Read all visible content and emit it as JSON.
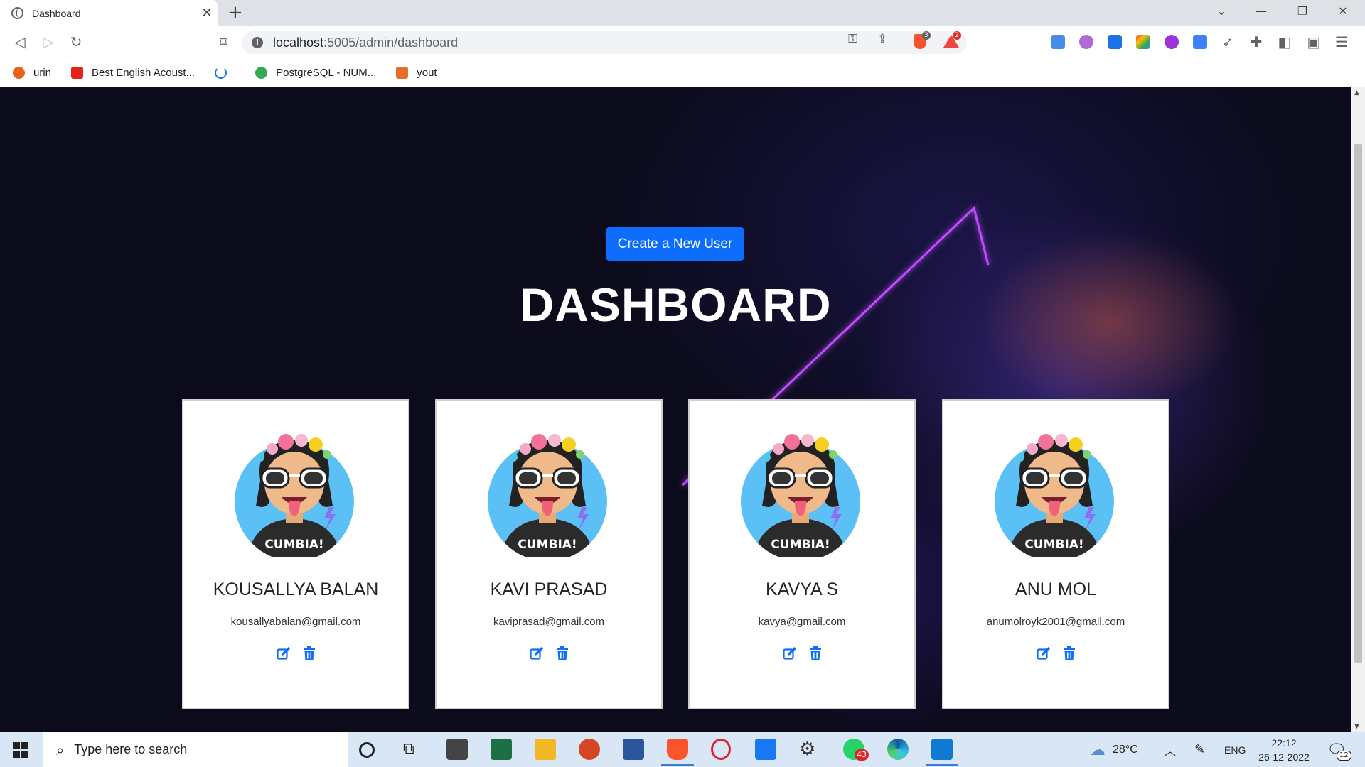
{
  "browser": {
    "tab_title": "Dashboard",
    "tab_close": "✕",
    "new_tab": "+",
    "url_host": "localhost",
    "url_path": ":5005/admin/dashboard",
    "shield_count": "3",
    "rewards_count": "2",
    "bookmarks": [
      {
        "label": "urin",
        "color": "#e8631a"
      },
      {
        "label": "Best English Acoust...",
        "color": "#e62117"
      },
      {
        "label": "",
        "color": "#1a73e8"
      },
      {
        "label": "PostgreSQL - NUM...",
        "color": "#34a853"
      },
      {
        "label": "yout",
        "color": "#ea6b2e"
      }
    ]
  },
  "page": {
    "create_button": "Create a New User",
    "title": "DASHBOARD",
    "users": [
      {
        "name": "KOUSALLYA BALAN",
        "email": "kousallyabalan@gmail.com"
      },
      {
        "name": "KAVI PRASAD",
        "email": "kaviprasad@gmail.com"
      },
      {
        "name": "KAVYA S",
        "email": "kavya@gmail.com"
      },
      {
        "name": "ANU MOL",
        "email": "anumolroyk2001@gmail.com"
      }
    ],
    "avatar_shirt_text": "CUMBIA!",
    "action_color": "#0d6efd"
  },
  "taskbar": {
    "search_placeholder": "Type here to search",
    "temperature": "28°C",
    "language": "ENG",
    "time": "22:12",
    "date": "26-12-2022",
    "whatsapp_badge": "43",
    "notification_count": "12"
  }
}
